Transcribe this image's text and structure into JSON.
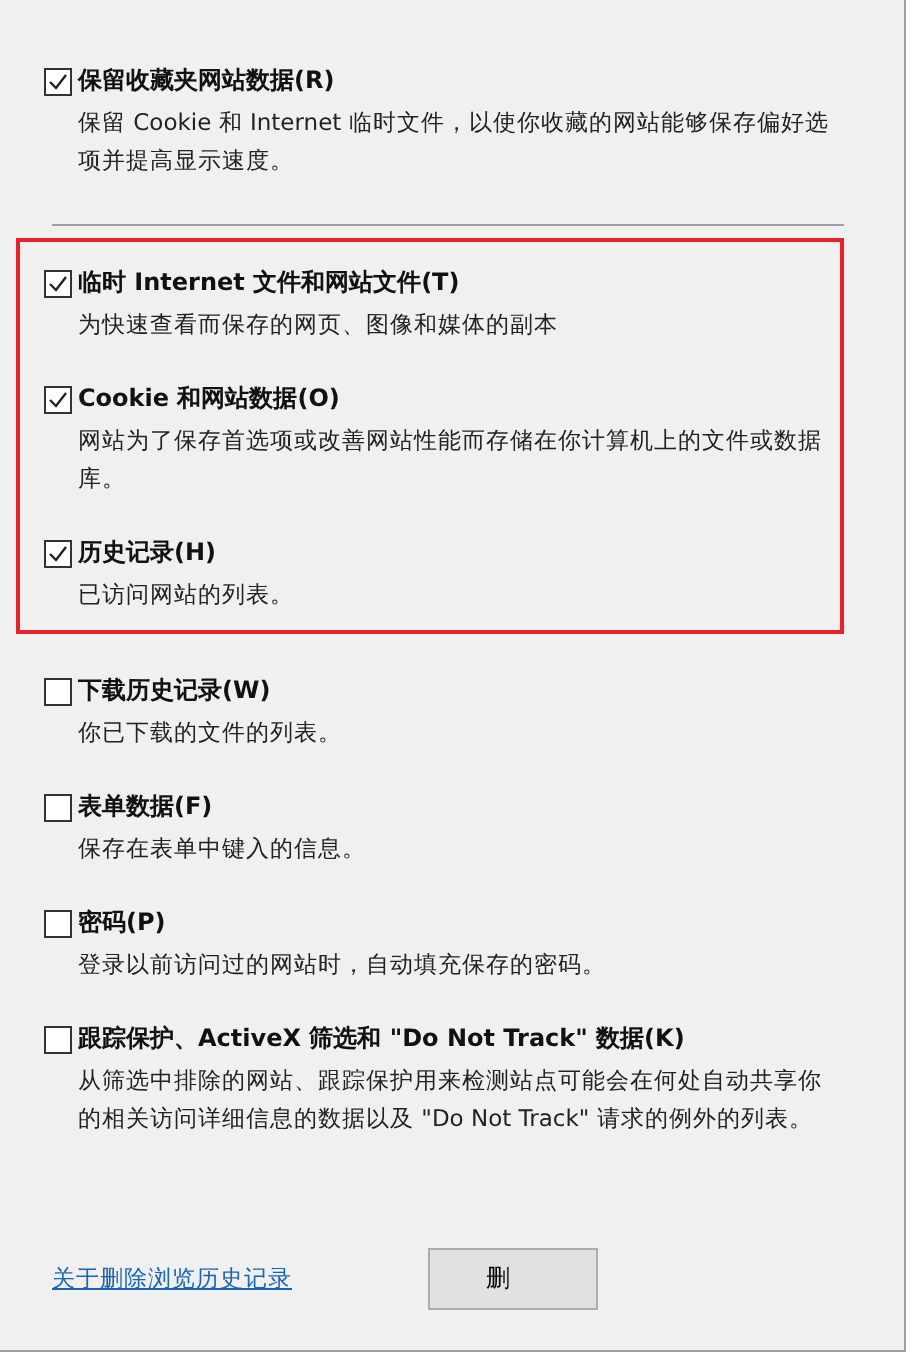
{
  "groups": [
    {
      "highlighted": false,
      "items": [
        {
          "label": "保留收藏夹网站数据(R)",
          "checked": true,
          "description": "保留 Cookie 和 Internet 临时文件，以使你收藏的网站能够保存偏好选项并提高显示速度。"
        }
      ]
    },
    {
      "highlighted": true,
      "items": [
        {
          "label": "临时 Internet 文件和网站文件(T)",
          "checked": true,
          "description": "为快速查看而保存的网页、图像和媒体的副本"
        },
        {
          "label": "Cookie 和网站数据(O)",
          "checked": true,
          "description": "网站为了保存首选项或改善网站性能而存储在你计算机上的文件或数据库。"
        },
        {
          "label": "历史记录(H)",
          "checked": true,
          "description": "已访问网站的列表。"
        }
      ]
    },
    {
      "highlighted": false,
      "items": [
        {
          "label": "下载历史记录(W)",
          "checked": false,
          "description": "你已下载的文件的列表。"
        },
        {
          "label": "表单数据(F)",
          "checked": false,
          "description": "保存在表单中键入的信息。"
        },
        {
          "label": "密码(P)",
          "checked": false,
          "description": "登录以前访问过的网站时，自动填充保存的密码。"
        },
        {
          "label": "跟踪保护、ActiveX 筛选和 \"Do Not Track\" 数据(K)",
          "checked": false,
          "description": "从筛选中排除的网站、跟踪保护用来检测站点可能会在何处自动共享你的相关访问详细信息的数据以及 \"Do Not Track\" 请求的例外的列表。"
        }
      ]
    }
  ],
  "footer": {
    "link": "关于删除浏览历史记录",
    "button": "删"
  }
}
